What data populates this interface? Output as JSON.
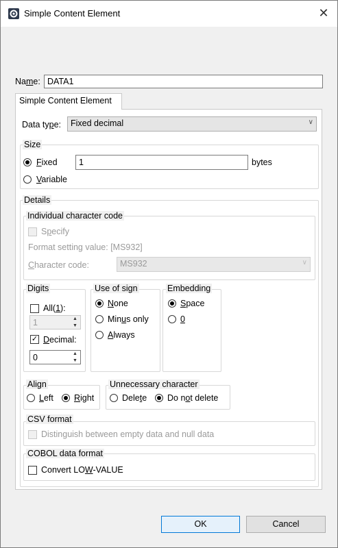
{
  "window": {
    "title": "Simple Content Element",
    "close_glyph": "✕"
  },
  "name_field": {
    "label_pre": "Na",
    "label_ul": "m",
    "label_post": "e:",
    "value": "DATA1"
  },
  "tab": {
    "label": "Simple Content Element"
  },
  "data_type": {
    "label_pre": "Data ty",
    "label_ul": "p",
    "label_post": "e:",
    "value": "Fixed decimal"
  },
  "size": {
    "group_label": "Size",
    "fixed": {
      "pre": "",
      "ul": "F",
      "post": "ixed",
      "selected": true
    },
    "value": "1",
    "unit": "bytes",
    "variable": {
      "pre": "",
      "ul": "V",
      "post": "ariable",
      "selected": false
    }
  },
  "details": {
    "group_label": "Details",
    "char_code": {
      "group_label": "Individual character code",
      "specify": {
        "pre": "S",
        "ul": "p",
        "post": "ecify"
      },
      "format_setting": "Format setting value: [MS932]",
      "char_code_label": {
        "pre": "",
        "ul": "C",
        "post": "haracter code:"
      },
      "char_code_value": "MS932"
    },
    "digits": {
      "group_label": "Digits",
      "all": {
        "pre": "All(",
        "ul": "1",
        "post": "):",
        "checked": false
      },
      "all_value": "1",
      "decimal": {
        "pre": "",
        "ul": "D",
        "post": "ecimal:",
        "checked": true
      },
      "decimal_value": "0"
    },
    "sign": {
      "group_label": "Use of sign",
      "none": {
        "pre": "",
        "ul": "N",
        "post": "one",
        "selected": true
      },
      "minus": {
        "pre": "Min",
        "ul": "u",
        "post": "s only",
        "selected": false
      },
      "always": {
        "pre": "",
        "ul": "A",
        "post": "lways",
        "selected": false
      }
    },
    "embedding": {
      "group_label": "Embedding",
      "space": {
        "pre": "",
        "ul": "S",
        "post": "pace",
        "selected": true
      },
      "zero": {
        "pre": "",
        "ul": "0",
        "post": "",
        "selected": false
      }
    },
    "align": {
      "group_label": "Align",
      "left": {
        "pre": "",
        "ul": "L",
        "post": "eft",
        "selected": false
      },
      "right": {
        "pre": "",
        "ul": "R",
        "post": "ight",
        "selected": true
      }
    },
    "unnecessary": {
      "group_label": "Unnecessary character",
      "delete": {
        "pre": "Dele",
        "ul": "t",
        "post": "e",
        "selected": false
      },
      "not_delete": {
        "pre": "Do n",
        "ul": "o",
        "post": "t delete",
        "selected": true
      }
    },
    "csv": {
      "group_label": "CSV format",
      "distinguish": "Distinguish between empty data and null data"
    },
    "cobol": {
      "group_label": "COBOL data format",
      "convert": {
        "pre": "Convert LO",
        "ul": "W",
        "post": "-VALUE",
        "checked": false
      }
    }
  },
  "buttons": {
    "ok": "OK",
    "cancel": "Cancel"
  }
}
